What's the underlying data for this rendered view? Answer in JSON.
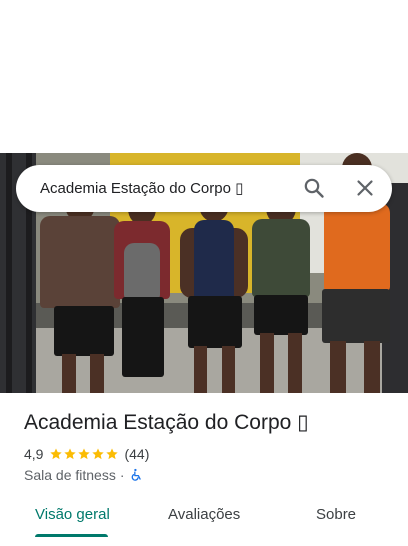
{
  "search": {
    "query": "Academia Estação do Corpo ▯"
  },
  "place": {
    "name": "Academia Estação do Corpo ▯",
    "rating": "4,9",
    "stars": 5,
    "review_count": "(44)",
    "category": "Sala de fitness",
    "separator": "·"
  },
  "tabs": [
    {
      "label": "Visão geral",
      "active": true
    },
    {
      "label": "Avaliações",
      "active": false
    },
    {
      "label": "Sobre",
      "active": false
    }
  ],
  "colors": {
    "accent": "#00796b",
    "star": "#fbbc04",
    "wheelchair": "#1a73e8"
  },
  "icons": {
    "search": "search-icon",
    "close": "close-icon",
    "accessibility": "wheelchair-icon"
  }
}
